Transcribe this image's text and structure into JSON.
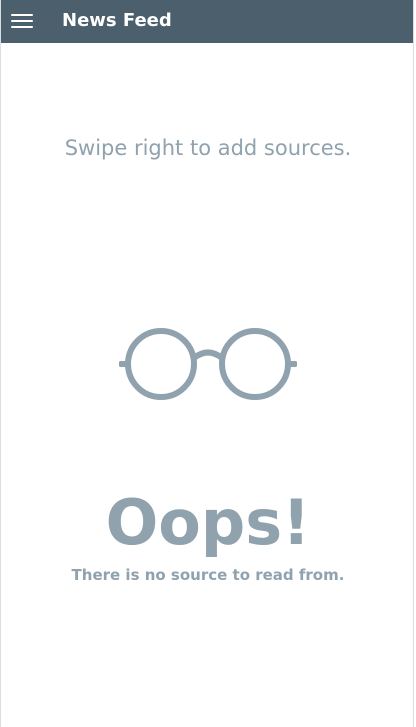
{
  "header": {
    "menu_icon": "hamburger-menu-icon",
    "title": "News Feed"
  },
  "empty_state": {
    "hint": "Swipe right to add sources.",
    "illustration_icon": "glasses-icon",
    "headline": "Oops!",
    "message": "There is no source to read from."
  },
  "colors": {
    "header_background": "#4b5f6c",
    "header_text": "#ffffff",
    "muted_text": "#8fa2ae",
    "background": "#ffffff"
  }
}
